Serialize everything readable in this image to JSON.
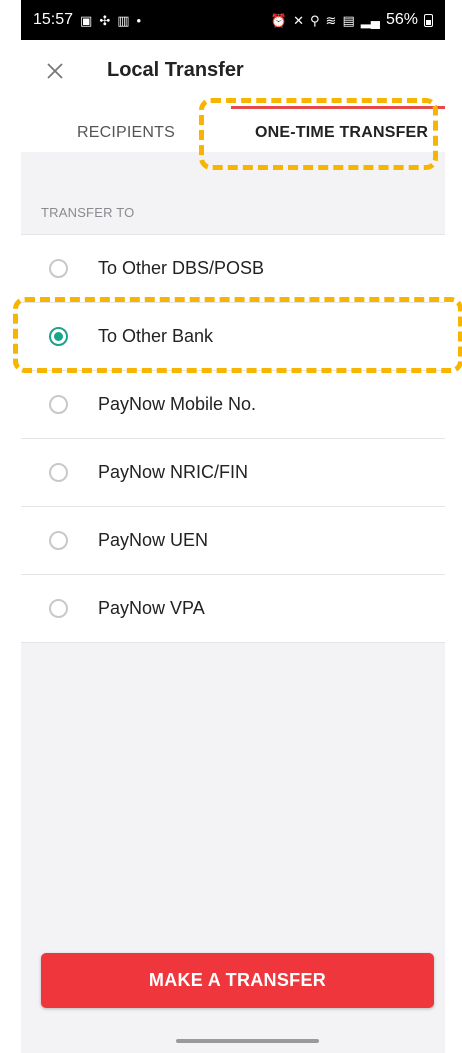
{
  "status_bar": {
    "time": "15:57",
    "left_icons": [
      "image-icon",
      "fan-icon",
      "linkedin-icon",
      "dot-icon"
    ],
    "right_icons": [
      "alarm-icon",
      "mute-icon",
      "location-icon",
      "wifi-icon",
      "volte-icon",
      "signal-icon"
    ],
    "battery": "56%"
  },
  "header": {
    "close_icon": "close-icon",
    "title": "Local Transfer"
  },
  "tabs": [
    {
      "label": "RECIPIENTS",
      "active": false
    },
    {
      "label": "ONE-TIME TRANSFER",
      "active": true
    }
  ],
  "section": {
    "label": "TRANSFER TO"
  },
  "options": [
    {
      "label": "To Other DBS/POSB",
      "selected": false
    },
    {
      "label": "To Other Bank",
      "selected": true
    },
    {
      "label": "PayNow Mobile No.",
      "selected": false
    },
    {
      "label": "PayNow NRIC/FIN",
      "selected": false
    },
    {
      "label": "PayNow UEN",
      "selected": false
    },
    {
      "label": "PayNow VPA",
      "selected": false
    }
  ],
  "actions": {
    "transfer_label": "MAKE A TRANSFER"
  },
  "colors": {
    "accent_red": "#f0363d",
    "radio_selected": "#1aa489",
    "highlight": "#f7b500"
  }
}
